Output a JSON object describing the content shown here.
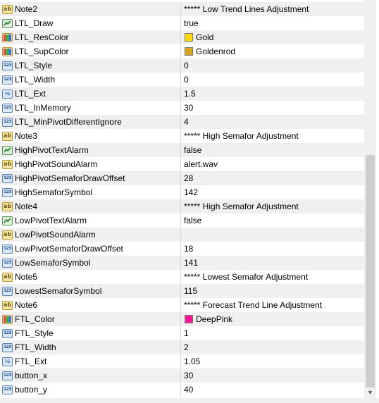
{
  "rows": [
    {
      "type": "string",
      "name": "Note2",
      "value": "***** Low Trend Lines Adjustment"
    },
    {
      "type": "bool",
      "name": "LTL_Draw",
      "value": "true"
    },
    {
      "type": "color",
      "name": "LTL_ResColor",
      "value": "Gold",
      "swatch": "#FFD700"
    },
    {
      "type": "color",
      "name": "LTL_SupColor",
      "value": "Goldenrod",
      "swatch": "#DAA520"
    },
    {
      "type": "int",
      "name": "LTL_Style",
      "value": "0"
    },
    {
      "type": "int",
      "name": "LTL_Width",
      "value": "0"
    },
    {
      "type": "double",
      "name": "LTL_Ext",
      "value": "1.5"
    },
    {
      "type": "int",
      "name": "LTL_InMemory",
      "value": "30"
    },
    {
      "type": "int",
      "name": "LTL_MinPivotDifferentIgnore",
      "value": "4"
    },
    {
      "type": "string",
      "name": "Note3",
      "value": "***** High Semafor Adjustment"
    },
    {
      "type": "bool",
      "name": "HighPivotTextAlarm",
      "value": "false"
    },
    {
      "type": "string",
      "name": "HighPivotSoundAlarm",
      "value": "alert.wav"
    },
    {
      "type": "int",
      "name": "HighPivotSemaforDrawOffset",
      "value": "28"
    },
    {
      "type": "int",
      "name": "HighSemaforSymbol",
      "value": "142"
    },
    {
      "type": "string",
      "name": "Note4",
      "value": "***** High Semafor Adjustment"
    },
    {
      "type": "bool",
      "name": "LowPivotTextAlarm",
      "value": "false"
    },
    {
      "type": "string",
      "name": "LowPivotSoundAlarm",
      "value": ""
    },
    {
      "type": "int",
      "name": "LowPivotSemaforDrawOffset",
      "value": "18"
    },
    {
      "type": "int",
      "name": "LowSemaforSymbol",
      "value": "141"
    },
    {
      "type": "string",
      "name": "Note5",
      "value": "***** Lowest Semafor Adjustment"
    },
    {
      "type": "int",
      "name": "LowestSemaforSymbol",
      "value": "115"
    },
    {
      "type": "string",
      "name": "Note6",
      "value": "***** Forecast Trend Line Adjustment"
    },
    {
      "type": "color",
      "name": "FTL_Color",
      "value": "DeepPink",
      "swatch": "#FF1493"
    },
    {
      "type": "int",
      "name": "FTL_Style",
      "value": "1"
    },
    {
      "type": "int",
      "name": "FTL_Width",
      "value": "2"
    },
    {
      "type": "double",
      "name": "FTL_Ext",
      "value": "1.05"
    },
    {
      "type": "int",
      "name": "button_x",
      "value": "30"
    },
    {
      "type": "int",
      "name": "button_y",
      "value": "40"
    }
  ],
  "type_icons": {
    "string": {
      "glyph": "ab",
      "icon": "string-type-icon"
    },
    "int": {
      "glyph": "123",
      "icon": "integer-type-icon"
    },
    "double": {
      "glyph": "½",
      "icon": "double-type-icon"
    },
    "bool": {
      "glyph": "",
      "icon": "bool-type-icon"
    },
    "color": {
      "glyph": "",
      "icon": "color-type-icon"
    }
  },
  "colors": {
    "row_alt": "#f0f0f0",
    "grid_line": "#d9d9d9"
  }
}
